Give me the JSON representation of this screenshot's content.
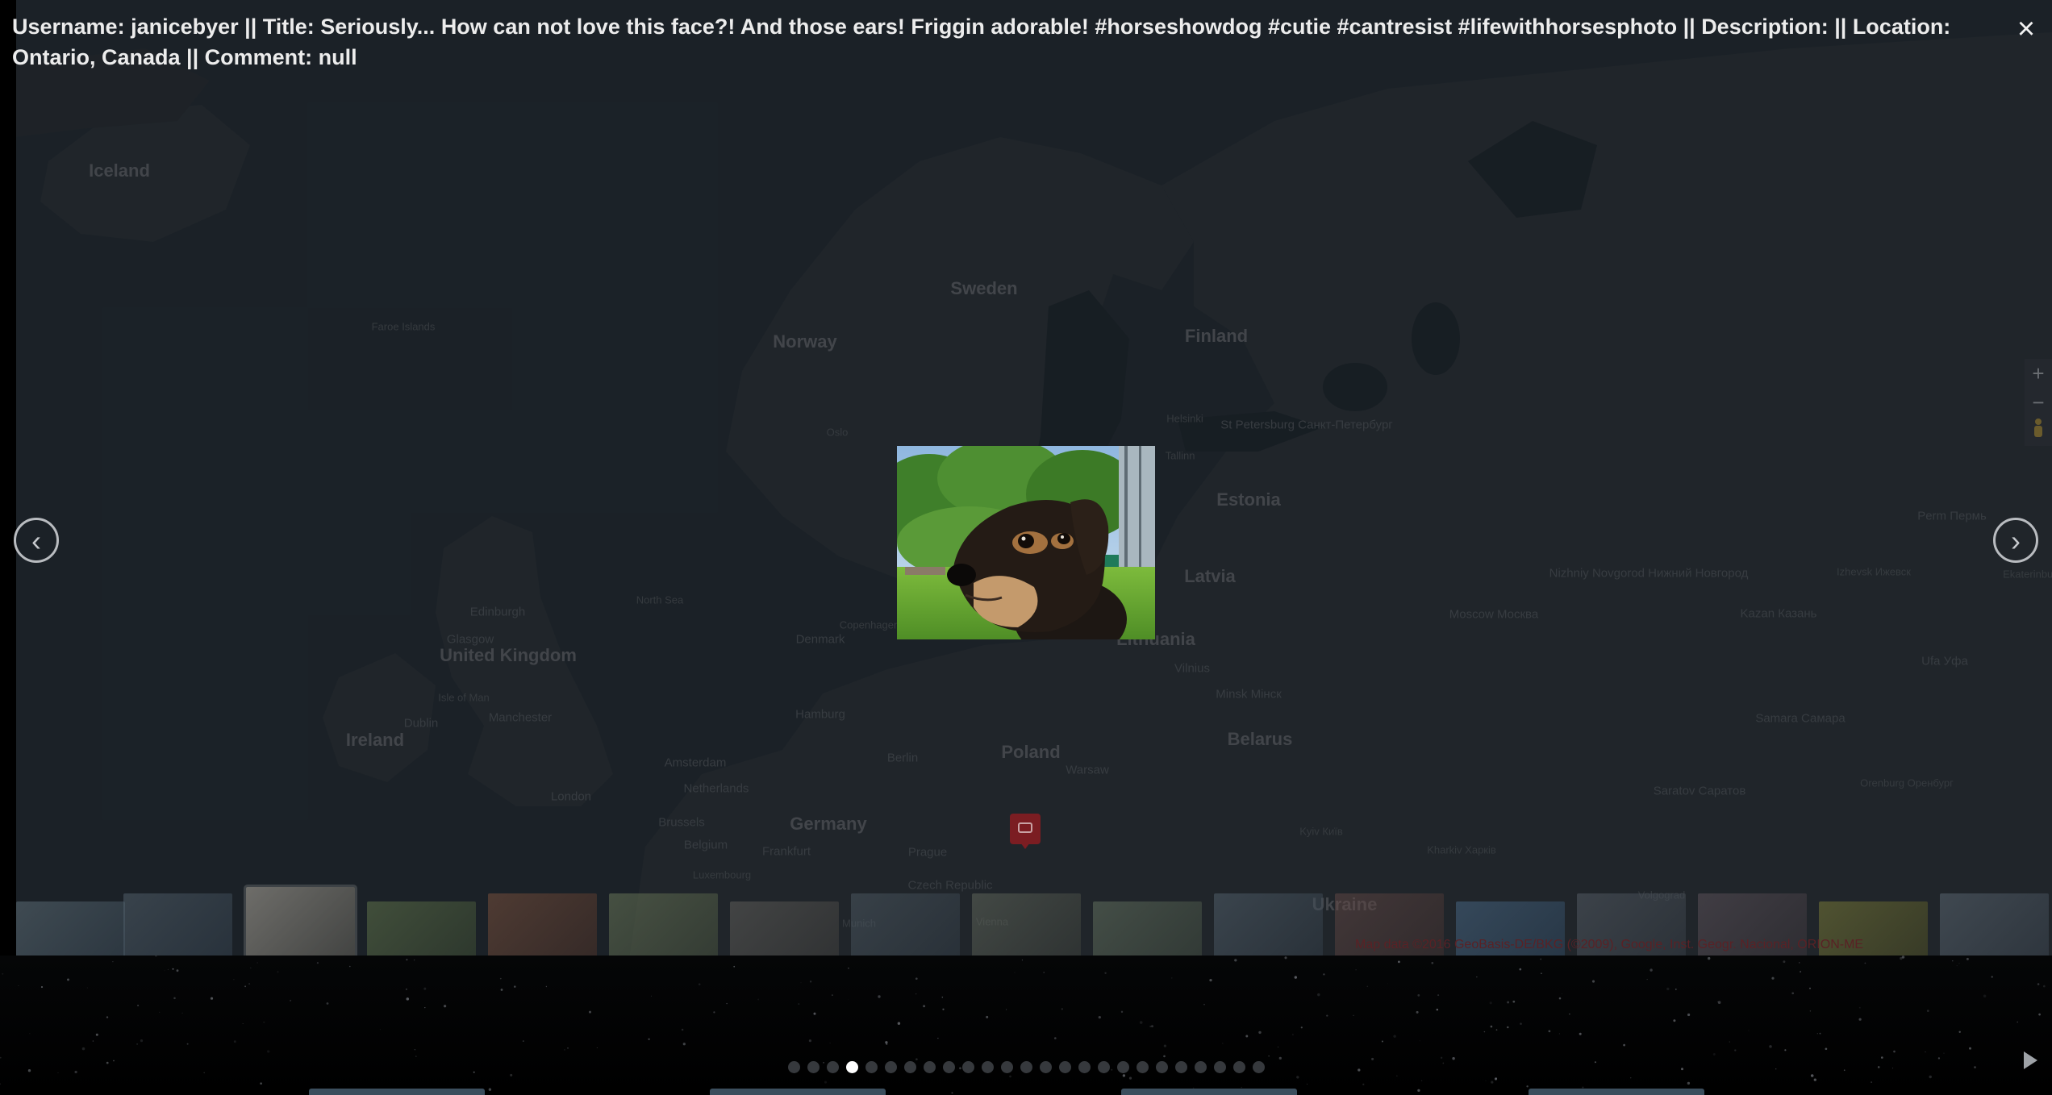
{
  "caption": {
    "text": "Username: janicebyer || Title: Seriously... How can not love this face?! And those ears! Friggin adorable! #horseshowdog #cutie #cantresist #lifewithhorsesphoto || Description: || Location: Ontario, Canada || Comment: null"
  },
  "controls": {
    "close_icon": "close-icon",
    "close_glyph": "×",
    "prev_glyph": "‹",
    "next_glyph": "›",
    "zoom_in_glyph": "+",
    "zoom_out_glyph": "−",
    "play_icon": "play-icon"
  },
  "map": {
    "labels": [
      {
        "text": "Iceland",
        "kind": "country"
      },
      {
        "text": "Faroe Islands",
        "kind": "small"
      },
      {
        "text": "Sweden",
        "kind": "country"
      },
      {
        "text": "Norway",
        "kind": "country"
      },
      {
        "text": "Finland",
        "kind": "country"
      },
      {
        "text": "Helsinki",
        "kind": "small"
      },
      {
        "text": "St Petersburg Санкт-Петербург",
        "kind": "city"
      },
      {
        "text": "Tallinn",
        "kind": "small"
      },
      {
        "text": "Estonia",
        "kind": "country"
      },
      {
        "text": "Latvia",
        "kind": "country"
      },
      {
        "text": "Oslo",
        "kind": "small"
      },
      {
        "text": "Edinburgh",
        "kind": "city"
      },
      {
        "text": "Glasgow",
        "kind": "city"
      },
      {
        "text": "United Kingdom",
        "kind": "country"
      },
      {
        "text": "Isle of Man",
        "kind": "small"
      },
      {
        "text": "Dublin",
        "kind": "city"
      },
      {
        "text": "Ireland",
        "kind": "country"
      },
      {
        "text": "Manchester",
        "kind": "city"
      },
      {
        "text": "London",
        "kind": "city"
      },
      {
        "text": "North Sea",
        "kind": "small"
      },
      {
        "text": "Denmark",
        "kind": "city"
      },
      {
        "text": "Copenhagen",
        "kind": "small"
      },
      {
        "text": "Hamburg",
        "kind": "city"
      },
      {
        "text": "Amsterdam",
        "kind": "city"
      },
      {
        "text": "Netherlands",
        "kind": "city"
      },
      {
        "text": "Brussels",
        "kind": "city"
      },
      {
        "text": "Belgium",
        "kind": "city"
      },
      {
        "text": "Luxembourg",
        "kind": "small"
      },
      {
        "text": "Germany",
        "kind": "country"
      },
      {
        "text": "Frankfurt",
        "kind": "city"
      },
      {
        "text": "Berlin",
        "kind": "city"
      },
      {
        "text": "Prague",
        "kind": "city"
      },
      {
        "text": "Czech Republic",
        "kind": "city"
      },
      {
        "text": "Munich",
        "kind": "small"
      },
      {
        "text": "Vienna",
        "kind": "small"
      },
      {
        "text": "Poland",
        "kind": "country"
      },
      {
        "text": "Warsaw",
        "kind": "city"
      },
      {
        "text": "Lithuania",
        "kind": "country"
      },
      {
        "text": "Vilnius",
        "kind": "city"
      },
      {
        "text": "Minsk Мінск",
        "kind": "city"
      },
      {
        "text": "Belarus",
        "kind": "country"
      },
      {
        "text": "Moscow Москва",
        "kind": "city"
      },
      {
        "text": "Nizhniy Novgorod Нижний Новгород",
        "kind": "city"
      },
      {
        "text": "Kazan Казань",
        "kind": "city"
      },
      {
        "text": "Izhevsk Ижевск",
        "kind": "small"
      },
      {
        "text": "Perm Пермь",
        "kind": "city"
      },
      {
        "text": "Ufa Уфа",
        "kind": "city"
      },
      {
        "text": "Samara Самара",
        "kind": "city"
      },
      {
        "text": "Saratov Саратов",
        "kind": "city"
      },
      {
        "text": "Orenburg Оренбург",
        "kind": "small"
      },
      {
        "text": "Kyiv Київ",
        "kind": "small"
      },
      {
        "text": "Kharkiv Харків",
        "kind": "small"
      },
      {
        "text": "Volgograd",
        "kind": "small"
      },
      {
        "text": "Ukraine",
        "kind": "country"
      },
      {
        "text": "Ekaterinburg",
        "kind": "small"
      }
    ]
  },
  "thumbnails": {
    "count": 17,
    "selected_index": 2
  },
  "attribution": {
    "text": "Map data ©2016 GeoBasis-DE/BKG (©2009), Google, Inst. Geogr. Nacional, ORION-ME"
  },
  "pager": {
    "total": 25,
    "active_index": 3
  },
  "bottom_tabs": {
    "count": 4
  },
  "colors": {
    "map_land": "#2d353c",
    "map_water": "#1f2730",
    "pin": "#7b1d22",
    "active_dot": "#ffffff",
    "inactive_dot": "#36393d"
  }
}
